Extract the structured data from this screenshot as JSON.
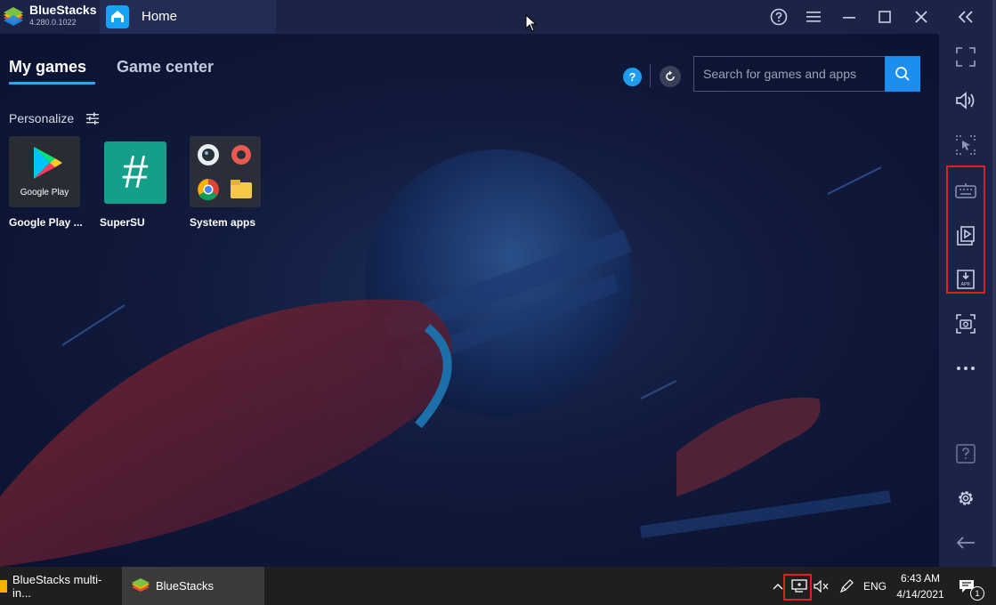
{
  "titlebar": {
    "app_name": "BlueStacks",
    "app_version": "4.280.0.1022",
    "home_tab_label": "Home",
    "buttons": [
      "help-icon",
      "menu-icon",
      "minimize-icon",
      "maximize-icon",
      "close-icon",
      "collapse-sidebar-icon"
    ]
  },
  "main": {
    "tabs": [
      {
        "label": "My games",
        "active": true
      },
      {
        "label": "Game center",
        "active": false
      }
    ],
    "help_badge": "?",
    "search": {
      "placeholder": "Search for games and apps"
    },
    "personalize_label": "Personalize",
    "apps": [
      {
        "label": "Google Play ...",
        "icon": "google-play-icon",
        "icon_caption": "Google Play"
      },
      {
        "label": "SuperSU",
        "icon": "supersu-icon",
        "icon_caption": "#"
      },
      {
        "label": "System apps",
        "icon": "system-apps-icon"
      }
    ]
  },
  "side_toolbar": {
    "items": [
      "fullscreen-icon",
      "volume-icon",
      "pointer-icon",
      "keyboard-icon",
      "media-manager-icon",
      "install-apk-icon",
      "screenshot-icon",
      "more-icon",
      "help-icon",
      "settings-icon",
      "back-icon"
    ],
    "apk_caption": "APK"
  },
  "taskbar": {
    "items": [
      {
        "label": "BlueStacks multi-in..."
      },
      {
        "label": "BlueStacks",
        "active": true
      }
    ],
    "language": "ENG",
    "time": "6:43 AM",
    "date": "4/14/2021",
    "notification_count": "1"
  },
  "colors": {
    "accent": "#1b8ef0",
    "titlebar_bg": "#1b2447",
    "content_bg": "#0d1330",
    "highlight_border": "#e02020"
  }
}
